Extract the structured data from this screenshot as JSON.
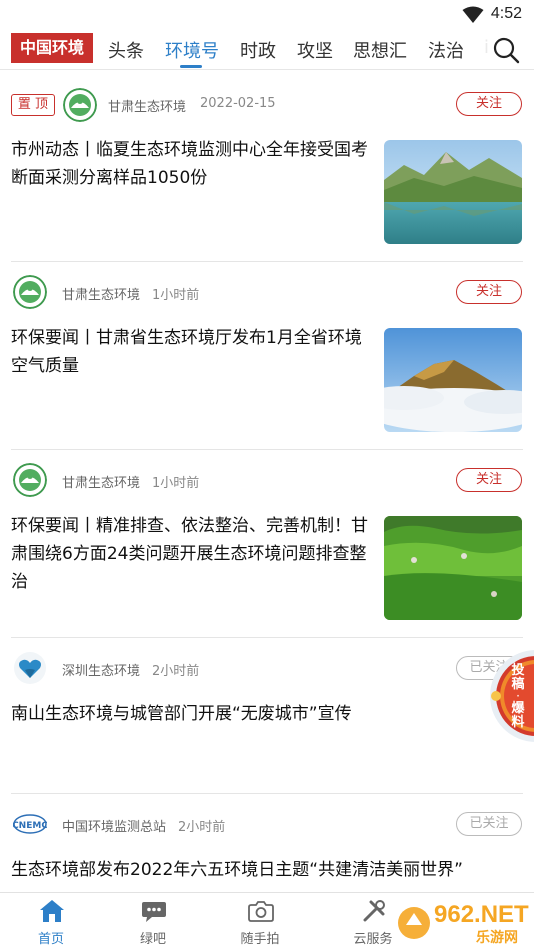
{
  "status_bar": {
    "time": "4:52"
  },
  "nav": {
    "brand": "中国环境",
    "tabs": [
      {
        "label": "头条",
        "active": false
      },
      {
        "label": "环境号",
        "active": true
      },
      {
        "label": "时政",
        "active": false
      },
      {
        "label": "攻坚",
        "active": false
      },
      {
        "label": "思想汇",
        "active": false
      },
      {
        "label": "法治",
        "active": false
      },
      {
        "label": "i",
        "active": false
      }
    ]
  },
  "feed": [
    {
      "pinned": true,
      "pin_label": "置 顶",
      "source": "甘肃生态环境",
      "time": "2022-02-15",
      "follow_label": "关注",
      "followed": false,
      "avatar_icon": "gansu-eco-emblem-icon",
      "title": "市州动态丨临夏生态环境监测中心全年接受国考断面采测分离样品1050份",
      "has_image": true,
      "image": "lake-mountain-photo"
    },
    {
      "pinned": false,
      "source": "甘肃生态环境",
      "time": "1小时前",
      "follow_label": "关注",
      "followed": false,
      "avatar_icon": "gansu-eco-emblem-icon",
      "title": "环保要闻丨甘肃省生态环境厅发布1月全省环境空气质量",
      "has_image": true,
      "image": "sea-of-clouds-photo"
    },
    {
      "pinned": false,
      "source": "甘肃生态环境",
      "time": "1小时前",
      "follow_label": "关注",
      "followed": false,
      "avatar_icon": "gansu-eco-emblem-icon",
      "title": "环保要闻丨精准排查、依法整治、完善机制！甘肃围绕6方面24类问题开展生态环境问题排查整治",
      "has_image": true,
      "image": "green-grassland-photo"
    },
    {
      "pinned": false,
      "source": "深圳生态环境",
      "time": "2小时前",
      "follow_label": "已关注",
      "followed": true,
      "avatar_icon": "shenzhen-heart-logo-icon",
      "title": "南山生态环境与城管部门开展“无废城市”宣传",
      "has_image": false
    },
    {
      "pinned": false,
      "source": "中国环境监测总站",
      "time": "2小时前",
      "follow_label": "已关注",
      "followed": true,
      "avatar_icon": "cnemc-logo-icon",
      "title": "生态环境部发布2022年六五环境日主题“共建清洁美丽世界”",
      "has_image": false
    }
  ],
  "float_badge": {
    "line1": "投",
    "line2": "稿",
    "line3": "·",
    "line4": "爆",
    "line5": "料"
  },
  "tabbar": [
    {
      "label": "首页",
      "icon": "home-icon",
      "active": true
    },
    {
      "label": "绿吧",
      "icon": "chat-bubble-icon",
      "active": false
    },
    {
      "label": "随手拍",
      "icon": "camera-icon",
      "active": false
    },
    {
      "label": "云服务",
      "icon": "tools-icon",
      "active": false
    }
  ],
  "watermark": {
    "brand": "962.NET",
    "sub": "乐游网"
  },
  "colors": {
    "accent_red": "#c8302c",
    "accent_blue": "#2d7fc8"
  }
}
